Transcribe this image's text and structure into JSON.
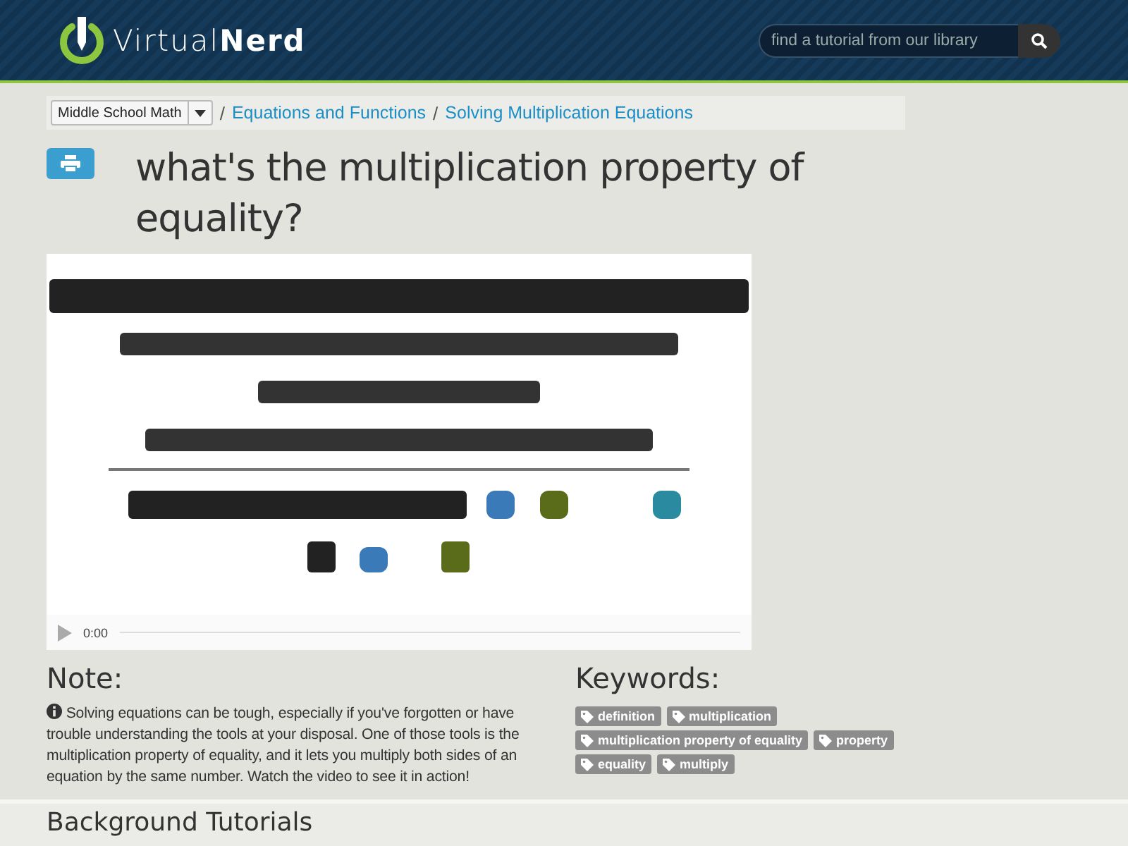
{
  "header": {
    "logo_text_light": "Virtual",
    "logo_text_bold": "Nerd",
    "search": {
      "placeholder": "find a tutorial from our library"
    }
  },
  "breadcrumb": {
    "dropdown": "Middle School Math",
    "links": [
      {
        "separator": "/",
        "label": "Equations and Functions"
      },
      {
        "separator": "/",
        "label": "Solving Multiplication Equations"
      }
    ]
  },
  "title": "what's the multiplication property of equality?",
  "video": {
    "kind": "picture",
    "time": "0:00"
  },
  "note": {
    "heading": "Note:",
    "text": "Solving equations can be tough, especially if you've forgotten or have trouble understanding the tools at your disposal. One of those tools is the multiplication property of equality, and it lets you multiply both sides of an equation by the same number. Watch the video to see it in action!"
  },
  "keywords": {
    "heading": "Keywords:",
    "tags": [
      "definition",
      "multiplication",
      "multiplication property of equality",
      "property",
      "equality",
      "multiply"
    ]
  },
  "background": {
    "heading": "Background Tutorials"
  }
}
